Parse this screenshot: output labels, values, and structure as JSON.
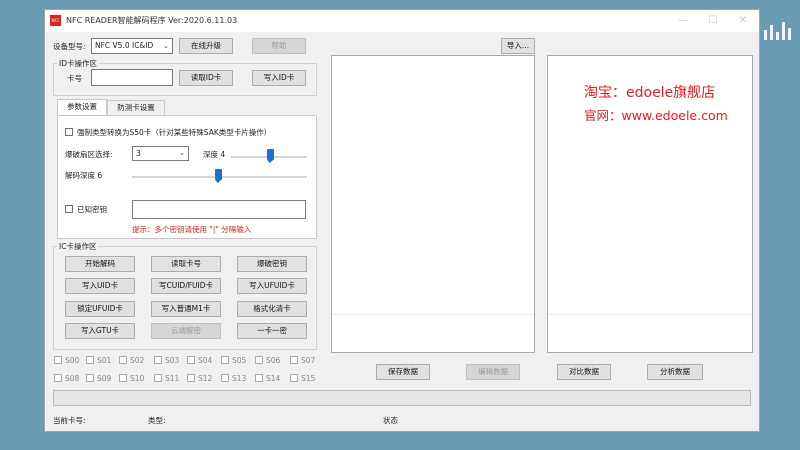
{
  "window": {
    "title": "NFC READER智能解码程序    Ver:2020.6.11.03",
    "app_icon_text": "NFC",
    "controls": {
      "minimize": "—",
      "maximize": "☐",
      "close": "✕"
    }
  },
  "top_row": {
    "device_label": "设备型号:",
    "device_value": "NFC V5.0 IC&ID",
    "upgrade_button": "在线升级",
    "help_button": "帮助",
    "import_button": "导入..."
  },
  "id_section": {
    "title": "ID卡操作区",
    "card_no_label": "卡号",
    "card_no_value": "",
    "read_button": "读取ID卡",
    "write_button": "写入ID卡"
  },
  "tabs": [
    {
      "label": "参数设置",
      "active": true
    },
    {
      "label": "防测卡设置",
      "active": false
    }
  ],
  "params": {
    "force_s50_label": "强制类型转换为S50卡（针对某些特殊SAK类型卡片操作）",
    "force_s50_checked": false,
    "crack_sector_label": "爆破扇区选择:",
    "crack_sector_value": "3",
    "depth_label": "深度 4",
    "depth_value": 4,
    "decode_depth_label": "解码深度 6",
    "decode_depth_value": 6,
    "known_key_label": "已知密钥",
    "known_key_checked": false,
    "known_key_value": "",
    "hint": "提示：多个密钥请使用 \"|\" 分隔输入"
  },
  "ic_section": {
    "title": "IC卡操作区",
    "buttons": [
      {
        "label": "开始解码",
        "enabled": true
      },
      {
        "label": "读取卡号",
        "enabled": true
      },
      {
        "label": "爆破密钥",
        "enabled": true
      },
      {
        "label": "写入UID卡",
        "enabled": true
      },
      {
        "label": "写CUID/FUID卡",
        "enabled": true
      },
      {
        "label": "写入UFUID卡",
        "enabled": true
      },
      {
        "label": "锁定UFUID卡",
        "enabled": true
      },
      {
        "label": "写入普通M1卡",
        "enabled": true
      },
      {
        "label": "格式化清卡",
        "enabled": true
      },
      {
        "label": "写入GTU卡",
        "enabled": true
      },
      {
        "label": "云端解密",
        "enabled": false
      },
      {
        "label": "一卡一密",
        "enabled": true
      }
    ]
  },
  "sectors": [
    "S00",
    "S01",
    "S02",
    "S03",
    "S04",
    "S05",
    "S06",
    "S07",
    "S08",
    "S09",
    "S10",
    "S11",
    "S12",
    "S13",
    "S14",
    "S15"
  ],
  "right_panel": {
    "promo_line1": "淘宝：edoele旗舰店",
    "promo_line2": "官网：www.edoele.com"
  },
  "bottom_buttons": [
    {
      "label": "保存数据",
      "enabled": true
    },
    {
      "label": "编辑数据",
      "enabled": false
    },
    {
      "label": "对比数据",
      "enabled": true
    },
    {
      "label": "分析数据",
      "enabled": true
    }
  ],
  "status_bar": {
    "current_card_label": "当前卡号:",
    "type_label": "类型:",
    "status_label": "状态"
  },
  "colors": {
    "accent_red": "#e02020",
    "slider_blue": "#1f6fd1",
    "desktop_bg": "#6a9bb4"
  }
}
